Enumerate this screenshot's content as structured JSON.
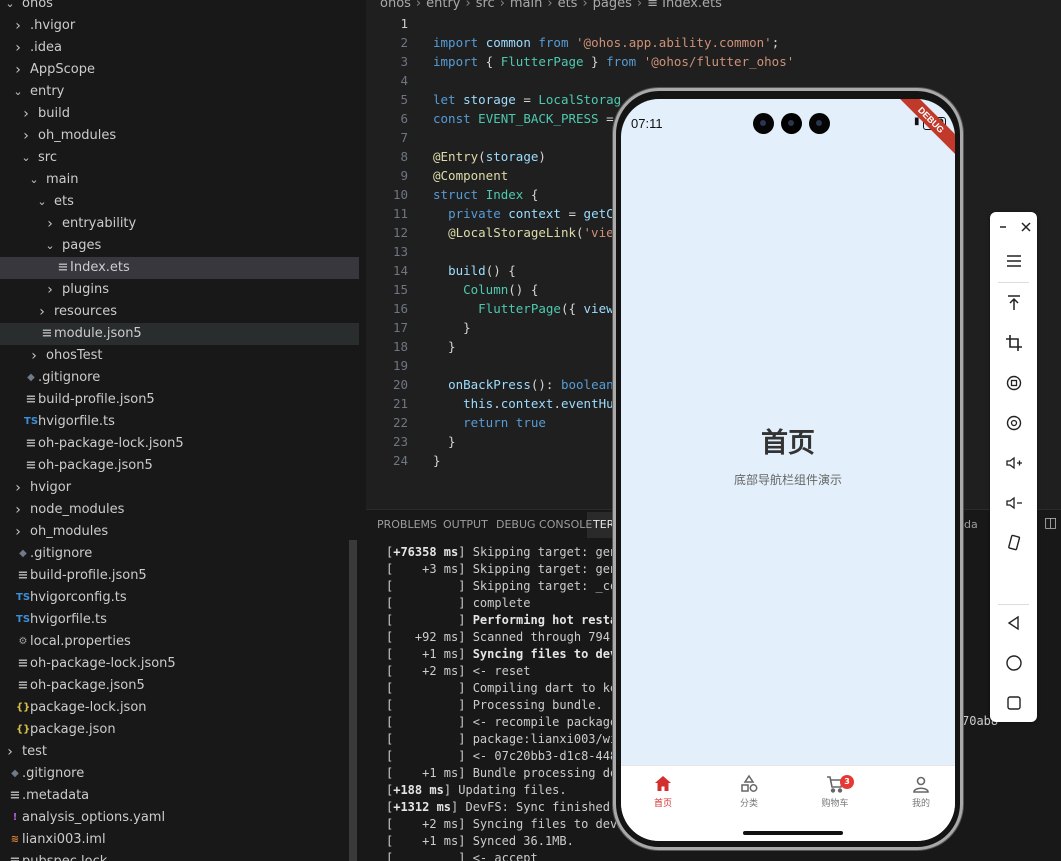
{
  "explorer": {
    "items": [
      {
        "label": "ohos",
        "depth": 0,
        "chevron": "down",
        "icon": ""
      },
      {
        "label": ".hvigor",
        "depth": 1,
        "chevron": "right",
        "icon": ""
      },
      {
        "label": ".idea",
        "depth": 1,
        "chevron": "right",
        "icon": ""
      },
      {
        "label": "AppScope",
        "depth": 1,
        "chevron": "right",
        "icon": ""
      },
      {
        "label": "entry",
        "depth": 1,
        "chevron": "down",
        "icon": ""
      },
      {
        "label": "build",
        "depth": 2,
        "chevron": "right",
        "icon": ""
      },
      {
        "label": "oh_modules",
        "depth": 2,
        "chevron": "right",
        "icon": ""
      },
      {
        "label": "src",
        "depth": 2,
        "chevron": "down",
        "icon": ""
      },
      {
        "label": "main",
        "depth": 3,
        "chevron": "down",
        "icon": ""
      },
      {
        "label": "ets",
        "depth": 4,
        "chevron": "down",
        "icon": ""
      },
      {
        "label": "entryability",
        "depth": 5,
        "chevron": "right",
        "icon": ""
      },
      {
        "label": "pages",
        "depth": 5,
        "chevron": "down",
        "icon": ""
      },
      {
        "label": "Index.ets",
        "depth": 6,
        "chevron": "",
        "icon": "lines",
        "selected": true
      },
      {
        "label": "plugins",
        "depth": 5,
        "chevron": "right",
        "icon": ""
      },
      {
        "label": "resources",
        "depth": 4,
        "chevron": "right",
        "icon": ""
      },
      {
        "label": "module.json5",
        "depth": 4,
        "chevron": "",
        "icon": "lines",
        "hover": true
      },
      {
        "label": "ohosTest",
        "depth": 3,
        "chevron": "right",
        "icon": ""
      },
      {
        "label": ".gitignore",
        "depth": 2,
        "chevron": "",
        "icon": "diamond"
      },
      {
        "label": "build-profile.json5",
        "depth": 2,
        "chevron": "",
        "icon": "lines"
      },
      {
        "label": "hvigorfile.ts",
        "depth": 2,
        "chevron": "",
        "icon": "TS"
      },
      {
        "label": "oh-package-lock.json5",
        "depth": 2,
        "chevron": "",
        "icon": "lines"
      },
      {
        "label": "oh-package.json5",
        "depth": 2,
        "chevron": "",
        "icon": "lines"
      },
      {
        "label": "hvigor",
        "depth": 1,
        "chevron": "right",
        "icon": ""
      },
      {
        "label": "node_modules",
        "depth": 1,
        "chevron": "right",
        "icon": ""
      },
      {
        "label": "oh_modules",
        "depth": 1,
        "chevron": "right",
        "icon": ""
      },
      {
        "label": ".gitignore",
        "depth": 1,
        "chevron": "",
        "icon": "diamond"
      },
      {
        "label": "build-profile.json5",
        "depth": 1,
        "chevron": "",
        "icon": "lines"
      },
      {
        "label": "hvigorconfig.ts",
        "depth": 1,
        "chevron": "",
        "icon": "TS"
      },
      {
        "label": "hvigorfile.ts",
        "depth": 1,
        "chevron": "",
        "icon": "TS"
      },
      {
        "label": "local.properties",
        "depth": 1,
        "chevron": "",
        "icon": "gear"
      },
      {
        "label": "oh-package-lock.json5",
        "depth": 1,
        "chevron": "",
        "icon": "lines"
      },
      {
        "label": "oh-package.json5",
        "depth": 1,
        "chevron": "",
        "icon": "lines"
      },
      {
        "label": "package-lock.json",
        "depth": 1,
        "chevron": "",
        "icon": "braces"
      },
      {
        "label": "package.json",
        "depth": 1,
        "chevron": "",
        "icon": "braces"
      },
      {
        "label": "test",
        "depth": 0,
        "chevron": "right",
        "icon": ""
      },
      {
        "label": ".gitignore",
        "depth": 0,
        "chevron": "",
        "icon": "diamond"
      },
      {
        "label": ".metadata",
        "depth": 0,
        "chevron": "",
        "icon": "lines"
      },
      {
        "label": "analysis_options.yaml",
        "depth": 0,
        "chevron": "",
        "icon": "exclaim"
      },
      {
        "label": "lianxi003.iml",
        "depth": 0,
        "chevron": "",
        "icon": "rss"
      },
      {
        "label": "pubspec.lock",
        "depth": 0,
        "chevron": "",
        "icon": "lines"
      }
    ]
  },
  "breadcrumb": [
    "ohos",
    "entry",
    "src",
    "main",
    "ets",
    "pages",
    "Index.ets"
  ],
  "code": {
    "current_line": 1,
    "lines": [
      "",
      "import common from '@ohos.app.ability.common';",
      "import { FlutterPage } from '@ohos/flutter_ohos'",
      "",
      "let storage = LocalStorag",
      "const EVENT_BACK_PRESS =",
      "",
      "@Entry(storage)",
      "@Component",
      "struct Index {",
      "  private context = getC",
      "  @LocalStorageLink('vie",
      "",
      "  build() {",
      "    Column() {",
      "      FlutterPage({ view",
      "    }",
      "  }",
      "",
      "  onBackPress(): boolean",
      "    this.context.eventHu",
      "    return true",
      "  }",
      "}"
    ]
  },
  "panel": {
    "tabs": [
      "PROBLEMS",
      "OUTPUT",
      "DEBUG CONSOLE",
      "TER"
    ],
    "active_tab": 3,
    "right_label": "da",
    "terminal_lines": [
      {
        "pre": "[",
        "bold": "+76358 ms",
        "post": "] Skipping target: gen_"
      },
      {
        "pre": "[    +3 ms] Skipping target: gen_c",
        "bold": "",
        "post": ""
      },
      {
        "pre": "[         ] Skipping target: _comp",
        "bold": "",
        "post": ""
      },
      {
        "pre": "[         ] complete",
        "bold": "",
        "post": ""
      },
      {
        "pre": "[         ] ",
        "bold": "Performing hot restart",
        "post": ""
      },
      {
        "pre": "[   +92 ms] Scanned through 794 fi",
        "bold": "",
        "post": ""
      },
      {
        "pre": "[    +1 ms] ",
        "bold": "Syncing files to devic",
        "post": ""
      },
      {
        "pre": "[    +2 ms] <- reset",
        "bold": "",
        "post": ""
      },
      {
        "pre": "[         ] Compiling dart to kern",
        "bold": "",
        "post": ""
      },
      {
        "pre": "[         ] Processing bundle.",
        "bold": "",
        "post": ""
      },
      {
        "pre": "[         ] <- recompile package:l",
        "bold": "",
        "post": ""
      },
      {
        "pre": "[         ] package:lianxi003/widg",
        "bold": "",
        "post": ""
      },
      {
        "pre": "[         ] <- 07c20bb3-d1c8-448a-",
        "bold": "",
        "post": ""
      },
      {
        "pre": "[    +1 ms] Bundle processing done",
        "bold": "",
        "post": ""
      },
      {
        "pre": "[",
        "bold": "+188 ms",
        "post": "] Updating files."
      },
      {
        "pre": "[",
        "bold": "+1312 ms",
        "post": "] DevFS: Sync finished"
      },
      {
        "pre": "[    +2 ms] Syncing files to devic",
        "bold": "",
        "post": ""
      },
      {
        "pre": "[    +1 ms] Synced 36.1MB.",
        "bold": "",
        "post": ""
      },
      {
        "pre": "[         ] <- accept",
        "bold": "",
        "post": ""
      }
    ],
    "overflow_text": "70ab8"
  },
  "phone": {
    "status_time": "07:11",
    "battery": "100",
    "debug_ribbon": "DEBUG",
    "title": "首页",
    "subtitle": "底部导航栏组件演示",
    "tabs": [
      {
        "label": "首页",
        "icon": "home-icon",
        "active": true
      },
      {
        "label": "分类",
        "icon": "category-icon",
        "active": false
      },
      {
        "label": "购物车",
        "icon": "cart-icon",
        "active": false,
        "badge": "3"
      },
      {
        "label": "我的",
        "icon": "person-icon",
        "active": false
      }
    ],
    "accent": "#d32f2f"
  },
  "emulator_toolbar": {
    "buttons": [
      "minimize",
      "close",
      "menu",
      "screenshot-top",
      "crop",
      "rotate-left",
      "rotate-right",
      "volume-up",
      "volume-down",
      "fold",
      "back",
      "home",
      "recents"
    ]
  }
}
